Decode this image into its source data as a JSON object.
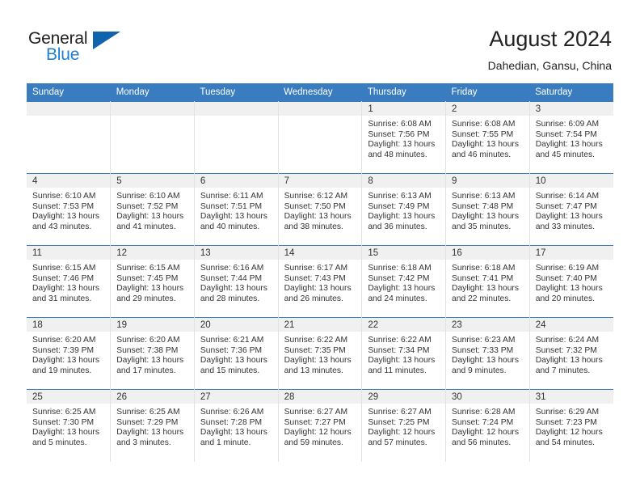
{
  "brand": {
    "name_part1": "General",
    "name_part2": "Blue",
    "accent_color": "#1f7fd0",
    "triangle_color": "#1163ad"
  },
  "header": {
    "title": "August 2024",
    "subtitle": "Dahedian, Gansu, China"
  },
  "theme": {
    "header_row_bg": "#3a7cc0",
    "daynum_band_bg": "#f0f0f0",
    "cell_border": "#e2e2e2",
    "text_color": "#333333"
  },
  "weekday_headers": [
    "Sunday",
    "Monday",
    "Tuesday",
    "Wednesday",
    "Thursday",
    "Friday",
    "Saturday"
  ],
  "weeks": [
    [
      {
        "day": "",
        "empty": true
      },
      {
        "day": "",
        "empty": true
      },
      {
        "day": "",
        "empty": true
      },
      {
        "day": "",
        "empty": true
      },
      {
        "day": "1",
        "sunrise": "Sunrise: 6:08 AM",
        "sunset": "Sunset: 7:56 PM",
        "daylight_line1": "Daylight: 13 hours",
        "daylight_line2": "and 48 minutes."
      },
      {
        "day": "2",
        "sunrise": "Sunrise: 6:08 AM",
        "sunset": "Sunset: 7:55 PM",
        "daylight_line1": "Daylight: 13 hours",
        "daylight_line2": "and 46 minutes."
      },
      {
        "day": "3",
        "sunrise": "Sunrise: 6:09 AM",
        "sunset": "Sunset: 7:54 PM",
        "daylight_line1": "Daylight: 13 hours",
        "daylight_line2": "and 45 minutes."
      }
    ],
    [
      {
        "day": "4",
        "sunrise": "Sunrise: 6:10 AM",
        "sunset": "Sunset: 7:53 PM",
        "daylight_line1": "Daylight: 13 hours",
        "daylight_line2": "and 43 minutes."
      },
      {
        "day": "5",
        "sunrise": "Sunrise: 6:10 AM",
        "sunset": "Sunset: 7:52 PM",
        "daylight_line1": "Daylight: 13 hours",
        "daylight_line2": "and 41 minutes."
      },
      {
        "day": "6",
        "sunrise": "Sunrise: 6:11 AM",
        "sunset": "Sunset: 7:51 PM",
        "daylight_line1": "Daylight: 13 hours",
        "daylight_line2": "and 40 minutes."
      },
      {
        "day": "7",
        "sunrise": "Sunrise: 6:12 AM",
        "sunset": "Sunset: 7:50 PM",
        "daylight_line1": "Daylight: 13 hours",
        "daylight_line2": "and 38 minutes."
      },
      {
        "day": "8",
        "sunrise": "Sunrise: 6:13 AM",
        "sunset": "Sunset: 7:49 PM",
        "daylight_line1": "Daylight: 13 hours",
        "daylight_line2": "and 36 minutes."
      },
      {
        "day": "9",
        "sunrise": "Sunrise: 6:13 AM",
        "sunset": "Sunset: 7:48 PM",
        "daylight_line1": "Daylight: 13 hours",
        "daylight_line2": "and 35 minutes."
      },
      {
        "day": "10",
        "sunrise": "Sunrise: 6:14 AM",
        "sunset": "Sunset: 7:47 PM",
        "daylight_line1": "Daylight: 13 hours",
        "daylight_line2": "and 33 minutes."
      }
    ],
    [
      {
        "day": "11",
        "sunrise": "Sunrise: 6:15 AM",
        "sunset": "Sunset: 7:46 PM",
        "daylight_line1": "Daylight: 13 hours",
        "daylight_line2": "and 31 minutes."
      },
      {
        "day": "12",
        "sunrise": "Sunrise: 6:15 AM",
        "sunset": "Sunset: 7:45 PM",
        "daylight_line1": "Daylight: 13 hours",
        "daylight_line2": "and 29 minutes."
      },
      {
        "day": "13",
        "sunrise": "Sunrise: 6:16 AM",
        "sunset": "Sunset: 7:44 PM",
        "daylight_line1": "Daylight: 13 hours",
        "daylight_line2": "and 28 minutes."
      },
      {
        "day": "14",
        "sunrise": "Sunrise: 6:17 AM",
        "sunset": "Sunset: 7:43 PM",
        "daylight_line1": "Daylight: 13 hours",
        "daylight_line2": "and 26 minutes."
      },
      {
        "day": "15",
        "sunrise": "Sunrise: 6:18 AM",
        "sunset": "Sunset: 7:42 PM",
        "daylight_line1": "Daylight: 13 hours",
        "daylight_line2": "and 24 minutes."
      },
      {
        "day": "16",
        "sunrise": "Sunrise: 6:18 AM",
        "sunset": "Sunset: 7:41 PM",
        "daylight_line1": "Daylight: 13 hours",
        "daylight_line2": "and 22 minutes."
      },
      {
        "day": "17",
        "sunrise": "Sunrise: 6:19 AM",
        "sunset": "Sunset: 7:40 PM",
        "daylight_line1": "Daylight: 13 hours",
        "daylight_line2": "and 20 minutes."
      }
    ],
    [
      {
        "day": "18",
        "sunrise": "Sunrise: 6:20 AM",
        "sunset": "Sunset: 7:39 PM",
        "daylight_line1": "Daylight: 13 hours",
        "daylight_line2": "and 19 minutes."
      },
      {
        "day": "19",
        "sunrise": "Sunrise: 6:20 AM",
        "sunset": "Sunset: 7:38 PM",
        "daylight_line1": "Daylight: 13 hours",
        "daylight_line2": "and 17 minutes."
      },
      {
        "day": "20",
        "sunrise": "Sunrise: 6:21 AM",
        "sunset": "Sunset: 7:36 PM",
        "daylight_line1": "Daylight: 13 hours",
        "daylight_line2": "and 15 minutes."
      },
      {
        "day": "21",
        "sunrise": "Sunrise: 6:22 AM",
        "sunset": "Sunset: 7:35 PM",
        "daylight_line1": "Daylight: 13 hours",
        "daylight_line2": "and 13 minutes."
      },
      {
        "day": "22",
        "sunrise": "Sunrise: 6:22 AM",
        "sunset": "Sunset: 7:34 PM",
        "daylight_line1": "Daylight: 13 hours",
        "daylight_line2": "and 11 minutes."
      },
      {
        "day": "23",
        "sunrise": "Sunrise: 6:23 AM",
        "sunset": "Sunset: 7:33 PM",
        "daylight_line1": "Daylight: 13 hours",
        "daylight_line2": "and 9 minutes."
      },
      {
        "day": "24",
        "sunrise": "Sunrise: 6:24 AM",
        "sunset": "Sunset: 7:32 PM",
        "daylight_line1": "Daylight: 13 hours",
        "daylight_line2": "and 7 minutes."
      }
    ],
    [
      {
        "day": "25",
        "sunrise": "Sunrise: 6:25 AM",
        "sunset": "Sunset: 7:30 PM",
        "daylight_line1": "Daylight: 13 hours",
        "daylight_line2": "and 5 minutes."
      },
      {
        "day": "26",
        "sunrise": "Sunrise: 6:25 AM",
        "sunset": "Sunset: 7:29 PM",
        "daylight_line1": "Daylight: 13 hours",
        "daylight_line2": "and 3 minutes."
      },
      {
        "day": "27",
        "sunrise": "Sunrise: 6:26 AM",
        "sunset": "Sunset: 7:28 PM",
        "daylight_line1": "Daylight: 13 hours",
        "daylight_line2": "and 1 minute."
      },
      {
        "day": "28",
        "sunrise": "Sunrise: 6:27 AM",
        "sunset": "Sunset: 7:27 PM",
        "daylight_line1": "Daylight: 12 hours",
        "daylight_line2": "and 59 minutes."
      },
      {
        "day": "29",
        "sunrise": "Sunrise: 6:27 AM",
        "sunset": "Sunset: 7:25 PM",
        "daylight_line1": "Daylight: 12 hours",
        "daylight_line2": "and 57 minutes."
      },
      {
        "day": "30",
        "sunrise": "Sunrise: 6:28 AM",
        "sunset": "Sunset: 7:24 PM",
        "daylight_line1": "Daylight: 12 hours",
        "daylight_line2": "and 56 minutes."
      },
      {
        "day": "31",
        "sunrise": "Sunrise: 6:29 AM",
        "sunset": "Sunset: 7:23 PM",
        "daylight_line1": "Daylight: 12 hours",
        "daylight_line2": "and 54 minutes."
      }
    ]
  ]
}
